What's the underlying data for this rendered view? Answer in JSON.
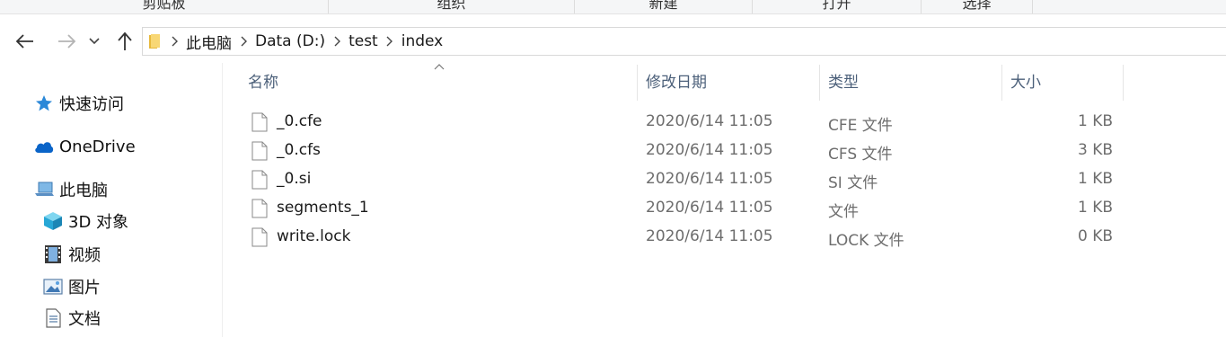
{
  "ribbon": {
    "groups": [
      "剪贴板",
      "组织",
      "新建",
      "打开",
      "选择"
    ]
  },
  "navigation": {
    "back_label": "Back",
    "forward_label": "Forward",
    "recent_label": "Recent locations",
    "up_label": "Up"
  },
  "breadcrumb": [
    "此电脑",
    "Data (D:)",
    "test",
    "index"
  ],
  "sidebar": {
    "items": [
      {
        "label": "快速访问",
        "icon": "star-icon"
      },
      {
        "label": "OneDrive",
        "icon": "cloud-icon"
      },
      {
        "label": "此电脑",
        "icon": "computer-icon"
      },
      {
        "label": "3D 对象",
        "icon": "cube-icon"
      },
      {
        "label": "视频",
        "icon": "video-icon"
      },
      {
        "label": "图片",
        "icon": "picture-icon"
      },
      {
        "label": "文档",
        "icon": "document-icon"
      }
    ]
  },
  "columns": {
    "name": "名称",
    "date": "修改日期",
    "type": "类型",
    "size": "大小"
  },
  "files": [
    {
      "name": "_0.cfe",
      "date": "2020/6/14 11:05",
      "type": "CFE 文件",
      "size": "1 KB"
    },
    {
      "name": "_0.cfs",
      "date": "2020/6/14 11:05",
      "type": "CFS 文件",
      "size": "3 KB"
    },
    {
      "name": "_0.si",
      "date": "2020/6/14 11:05",
      "type": "SI 文件",
      "size": "1 KB"
    },
    {
      "name": "segments_1",
      "date": "2020/6/14 11:05",
      "type": "文件",
      "size": "1 KB"
    },
    {
      "name": "write.lock",
      "date": "2020/6/14 11:05",
      "type": "LOCK 文件",
      "size": "0 KB"
    }
  ],
  "colors": {
    "accent": "#0078d7",
    "header_text": "#4c607a",
    "secondary_text": "#6d6d6d",
    "folder_yellow": "#f8d775"
  }
}
